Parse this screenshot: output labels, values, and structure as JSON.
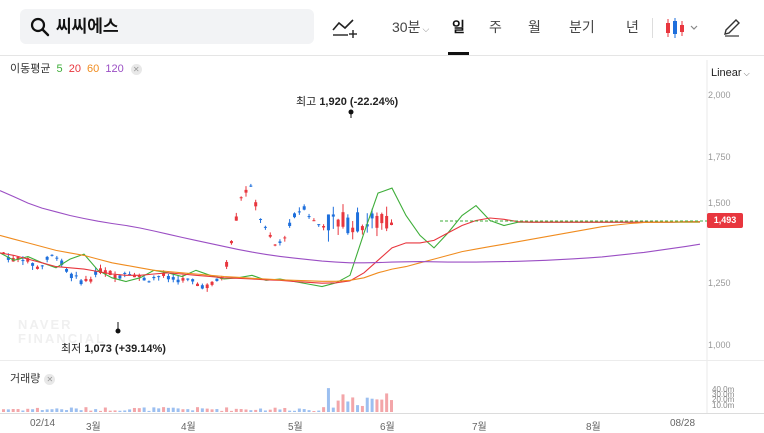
{
  "search": {
    "query": "씨씨에스"
  },
  "toolbar": {
    "interval_30": "30분",
    "tab_day": "일",
    "tab_week": "주",
    "tab_month": "월",
    "tab_quarter": "분기",
    "tab_year": "년"
  },
  "indicator": {
    "label": "이동평균",
    "ma5": "5",
    "ma20": "20",
    "ma60": "60",
    "ma120": "120"
  },
  "scale": {
    "label": "Linear"
  },
  "yaxis": [
    "2,000",
    "1,750",
    "1,500",
    "1,250",
    "1,000"
  ],
  "current_price": "1,493",
  "high": {
    "prefix": "최고",
    "value": "1,920",
    "pct": "(-22.24%)"
  },
  "low": {
    "prefix": "최저",
    "value": "1,073",
    "pct": "(+39.14%)"
  },
  "watermark": {
    "line1": "NAVER",
    "line2": "FINANCIAL"
  },
  "volume": {
    "label": "거래량",
    "ticks": [
      "40.0m",
      "30.0m",
      "20.0m",
      "10.0m"
    ]
  },
  "xaxis": [
    "02/14",
    "3월",
    "4월",
    "5월",
    "6월",
    "7월",
    "8월",
    "08/28"
  ],
  "colors": {
    "up": "#e8363e",
    "down": "#1e6fdc",
    "ma5": "#3fae3a",
    "ma20": "#e8363e",
    "ma60": "#f08c1f",
    "ma120": "#9b4fc4",
    "accent": "#e8363e"
  },
  "chart_data": {
    "type": "candlestick",
    "ylim": [
      1000,
      2000
    ],
    "scale": "Linear",
    "current": 1493,
    "max": 1920,
    "min": 1073,
    "series": [
      {
        "name": "5",
        "values": [
          1370,
          1340,
          1355,
          1330,
          1310,
          1345,
          1365,
          1300,
          1270,
          1255,
          1270,
          1300,
          1290,
          1275,
          1300,
          1280,
          1265,
          1270,
          1280,
          1260,
          1265,
          1255,
          1245,
          1235,
          1250,
          1280,
          1450,
          1610,
          1630,
          1520,
          1440,
          1390,
          1450,
          1520,
          1560,
          1500,
          1480,
          1493,
          1493,
          1493,
          1493,
          1493,
          1493,
          1493,
          1493,
          1493,
          1493,
          1493,
          1493,
          1493,
          1493
        ]
      },
      {
        "name": "20",
        "values": [
          1370,
          1360,
          1345,
          1330,
          1315,
          1310,
          1305,
          1295,
          1285,
          1280,
          1280,
          1285,
          1290,
          1285,
          1280,
          1275,
          1270,
          1268,
          1265,
          1262,
          1260,
          1255,
          1252,
          1248,
          1250,
          1258,
          1290,
          1340,
          1390,
          1410,
          1410,
          1420,
          1450,
          1480,
          1500,
          1510,
          1505,
          1495,
          1493,
          1493,
          1493,
          1493,
          1493,
          1493,
          1493,
          1493,
          1493,
          1493,
          1493,
          1495,
          1495
        ]
      },
      {
        "name": "60",
        "values": [
          1440,
          1425,
          1410,
          1395,
          1380,
          1370,
          1360,
          1345,
          1330,
          1320,
          1310,
          1300,
          1295,
          1290,
          1285,
          1280,
          1275,
          1272,
          1268,
          1265,
          1262,
          1260,
          1258,
          1256,
          1256,
          1260,
          1270,
          1290,
          1305,
          1315,
          1330,
          1345,
          1360,
          1375,
          1385,
          1395,
          1405,
          1415,
          1425,
          1435,
          1445,
          1455,
          1465,
          1475,
          1482,
          1488,
          1492,
          1493,
          1494,
          1494,
          1494
        ]
      },
      {
        "name": "120",
        "values": [
          1620,
          1595,
          1570,
          1550,
          1535,
          1520,
          1508,
          1497,
          1488,
          1480,
          1470,
          1458,
          1445,
          1432,
          1420,
          1408,
          1396,
          1384,
          1373,
          1364,
          1356,
          1349,
          1343,
          1337,
          1333,
          1330,
          1330,
          1331,
          1333,
          1334,
          1335,
          1334,
          1333,
          1333,
          1333,
          1334,
          1335,
          1336,
          1338,
          1340,
          1343,
          1346,
          1350,
          1354,
          1360,
          1366,
          1372,
          1380,
          1388,
          1396,
          1405
        ]
      }
    ]
  }
}
